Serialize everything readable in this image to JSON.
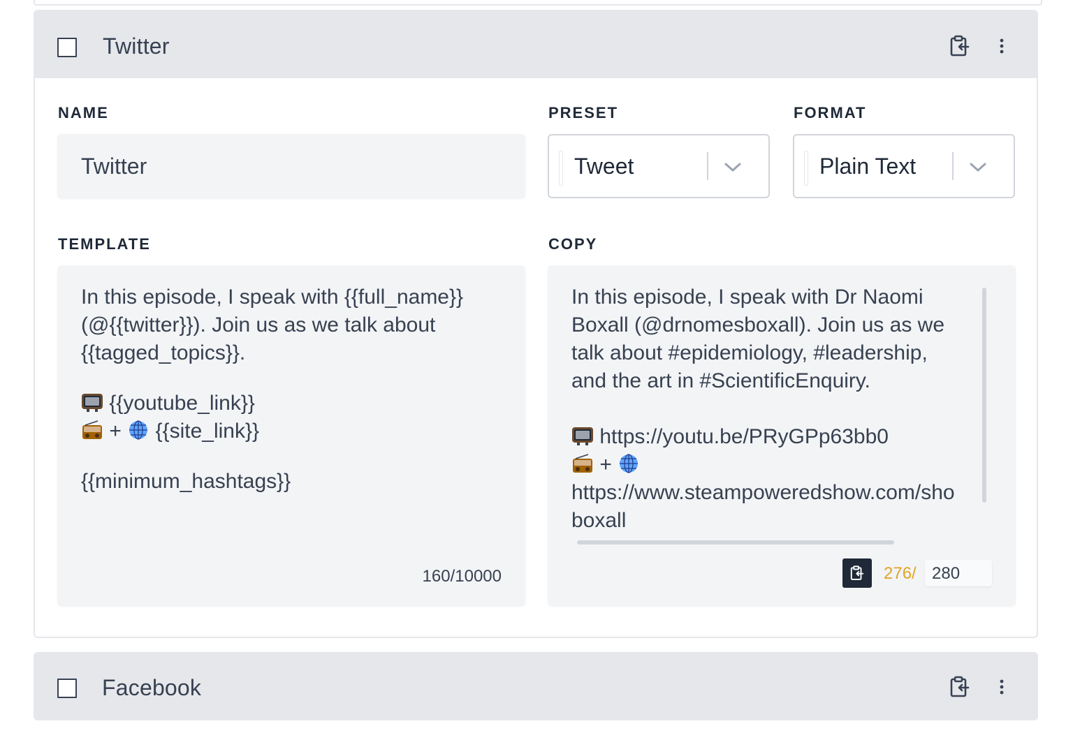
{
  "cards": [
    {
      "title": "Twitter",
      "expanded": true,
      "fields": {
        "name_label": "NAME",
        "name_value": "Twitter",
        "preset_label": "PRESET",
        "preset_value": "Tweet",
        "format_label": "FORMAT",
        "format_value": "Plain Text",
        "template_label": "TEMPLATE",
        "template_lines": {
          "intro_1": "In this episode, I speak with {{full_name}}",
          "intro_2": "(@{{twitter}}). Join us as we talk about",
          "intro_3": "{{tagged_topics}}.",
          "youtube": " {{youtube_link}}",
          "site": " {{site_link}}",
          "plus": " + ",
          "hashtags": "{{minimum_hashtags}}"
        },
        "template_count": "160/10000",
        "copy_label": "COPY",
        "copy_lines": {
          "intro_1": "In this episode, I speak with Dr Naomi",
          "intro_2": "Boxall (@drnomesboxall). Join us as we",
          "intro_3": "talk about #epidemiology, #leadership,",
          "intro_4": "and the art in #ScientificEnquiry.",
          "youtube": " https://youtu.be/PRyGPp63bb0",
          "plus": " + ",
          "site_1": "https://www.steampoweredshow.com/sho",
          "site_2": "boxall"
        },
        "copy_count_used": "276/",
        "copy_count_max": "280"
      }
    },
    {
      "title": "Facebook",
      "expanded": false
    }
  ],
  "icons": {
    "header_copy": "clipboard-copy-icon",
    "header_menu": "vertical-dots-icon",
    "select_caret": "chevron-down-icon",
    "tv": "television-icon",
    "radio": "radio-icon",
    "globe": "globe-icon"
  },
  "colors": {
    "header_bg": "#e5e7eb",
    "field_bg": "#f3f4f6",
    "count_warning": "#e0a526",
    "copy_button": "#1f2937"
  }
}
